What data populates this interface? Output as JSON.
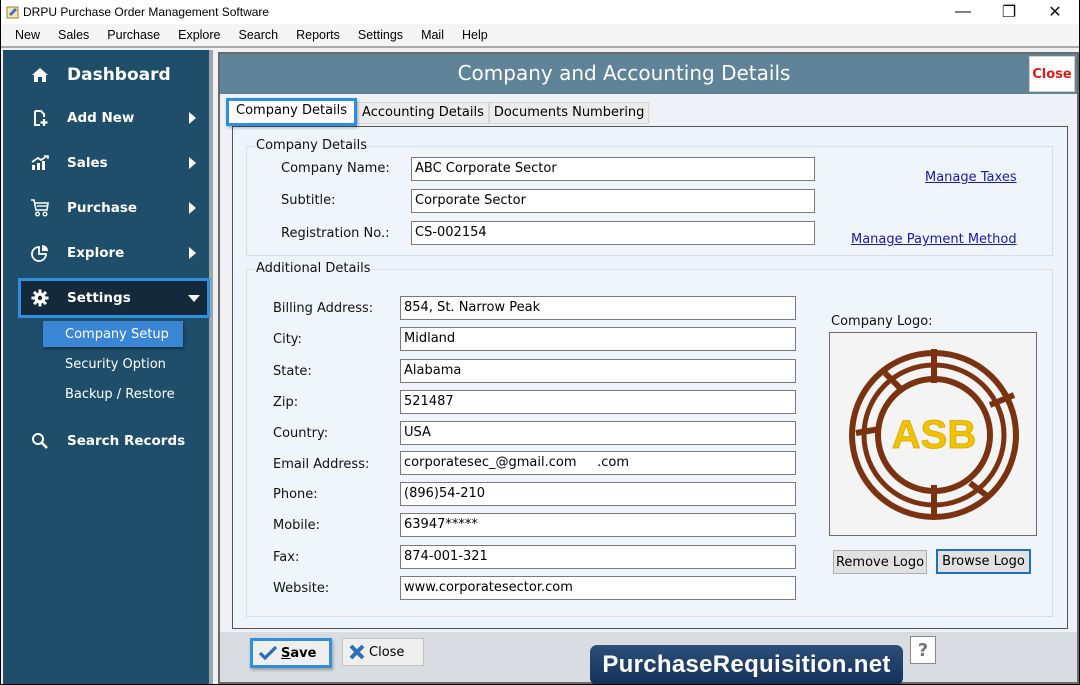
{
  "window": {
    "title": "DRPU Purchase Order Management Software",
    "controls": {
      "minimize": "—",
      "maximize": "❐",
      "close": "✕"
    }
  },
  "menubar": [
    "New",
    "Sales",
    "Purchase",
    "Explore",
    "Search",
    "Reports",
    "Settings",
    "Mail",
    "Help"
  ],
  "sidebar": {
    "dashboard": {
      "label": "Dashboard",
      "icon": "home-icon"
    },
    "items": [
      {
        "label": "Add New",
        "icon": "add-document-icon"
      },
      {
        "label": "Sales",
        "icon": "chart-up-icon"
      },
      {
        "label": "Purchase",
        "icon": "cart-icon"
      },
      {
        "label": "Explore",
        "icon": "pie-chart-icon"
      }
    ],
    "settings": {
      "label": "Settings",
      "icon": "gear-icon",
      "expanded": true,
      "subitems": [
        {
          "label": "Company Setup",
          "active": true
        },
        {
          "label": "Security Option",
          "active": false
        },
        {
          "label": "Backup / Restore",
          "active": false
        }
      ]
    },
    "search": {
      "label": "Search Records",
      "icon": "search-icon"
    }
  },
  "panel": {
    "title": "Company and Accounting Details",
    "close_label": "Close",
    "tabs": [
      {
        "label": "Company Details",
        "active": true
      },
      {
        "label": "Accounting Details",
        "active": false
      },
      {
        "label": "Documents Numbering",
        "active": false
      }
    ],
    "company_details": {
      "group_title": "Company Details",
      "fields": [
        {
          "label": "Company Name:",
          "value": "ABC Corporate Sector"
        },
        {
          "label": "Subtitle:",
          "value": "Corporate Sector"
        },
        {
          "label": "Registration No.:",
          "value": "CS-002154"
        }
      ],
      "links": {
        "manage_taxes": "Manage Taxes",
        "manage_payment": "Manage Payment Method"
      }
    },
    "additional_details": {
      "group_title": "Additional Details",
      "fields": [
        {
          "label": "Billing Address:",
          "value": "854, St. Narrow Peak"
        },
        {
          "label": "City:",
          "value": "Midland"
        },
        {
          "label": "State:",
          "value": "Alabama"
        },
        {
          "label": "Zip:",
          "value": "521487"
        },
        {
          "label": "Country:",
          "value": "USA"
        },
        {
          "label": "Email Address:",
          "value": "corporatesec_@gmail.com     .com"
        },
        {
          "label": "Phone:",
          "value": "(896)54-210"
        },
        {
          "label": "Mobile:",
          "value": "63947*****"
        },
        {
          "label": "Fax:",
          "value": "874-001-321"
        },
        {
          "label": "Website:",
          "value": "www.corporatesector.com"
        }
      ],
      "logo": {
        "label": "Company Logo:",
        "logo_text": "ASB",
        "remove_label": "Remove Logo",
        "browse_label": "Browse Logo"
      }
    },
    "footer": {
      "save_label": "Save",
      "save_mnemonic": "S",
      "close_label": "Close",
      "help_label": "?"
    }
  },
  "watermark": "PurchaseRequisition.net",
  "colors": {
    "sidebar_bg": "#1f4e6b",
    "header_bg": "#5f8499",
    "focus_blue": "#2e8ee0",
    "close_red": "#e01818",
    "link": "#1a1aa6",
    "logo_ring": "#7a3210",
    "logo_text": "#f2c200"
  }
}
